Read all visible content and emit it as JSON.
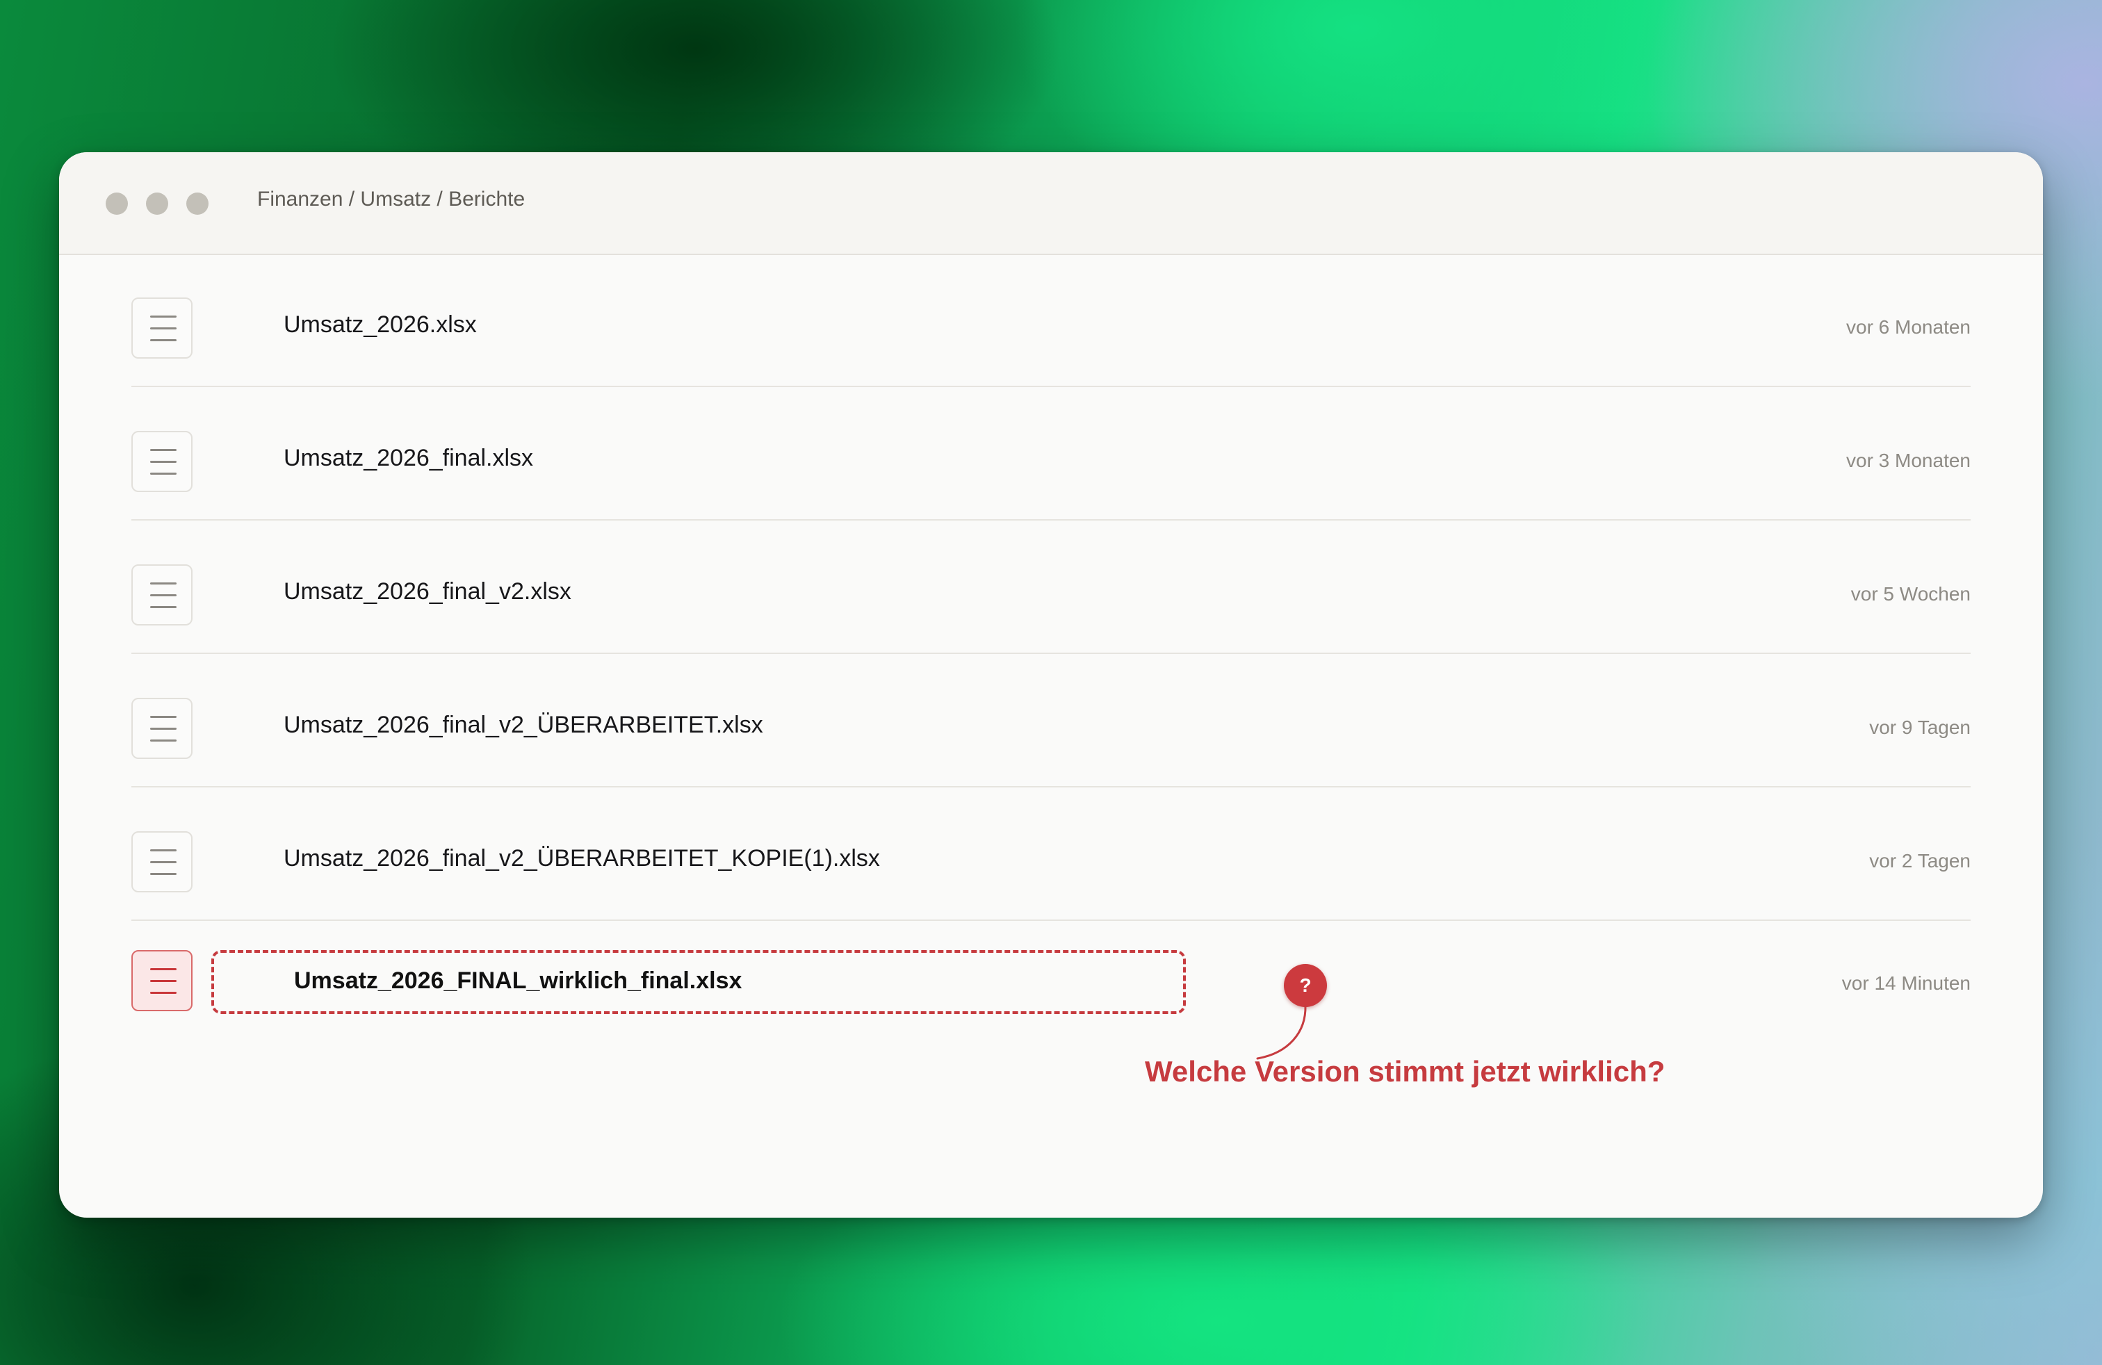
{
  "window": {
    "breadcrumb": "Finanzen / Umsatz / Berichte"
  },
  "files": [
    {
      "name": "Umsatz_2026.xlsx",
      "modified": "vor 6 Monaten",
      "icon": "file-icon"
    },
    {
      "name": "Umsatz_2026_final.xlsx",
      "modified": "vor 3 Monaten",
      "icon": "file-icon"
    },
    {
      "name": "Umsatz_2026_final_v2.xlsx",
      "modified": "vor 5 Wochen",
      "icon": "file-icon"
    },
    {
      "name": "Umsatz_2026_final_v2_ÜBERARBEITET.xlsx",
      "modified": "vor 9 Tagen",
      "icon": "file-icon"
    },
    {
      "name": "Umsatz_2026_final_v2_ÜBERARBEITET_KOPIE(1).xlsx",
      "modified": "vor 2 Tagen",
      "icon": "file-icon"
    },
    {
      "name": "Umsatz_2026_FINAL_wirklich_final.xlsx",
      "modified": "vor 14 Minuten",
      "icon": "file-icon",
      "highlighted": true
    }
  ],
  "annotation": {
    "badge": "?",
    "text": "Welche Version stimmt jetzt wirklich?",
    "color": "#c63b3f"
  },
  "colors": {
    "window_bg": "#fafaf9",
    "titlebar_bg": "#f6f5f2",
    "highlight": "#c63b3f"
  }
}
